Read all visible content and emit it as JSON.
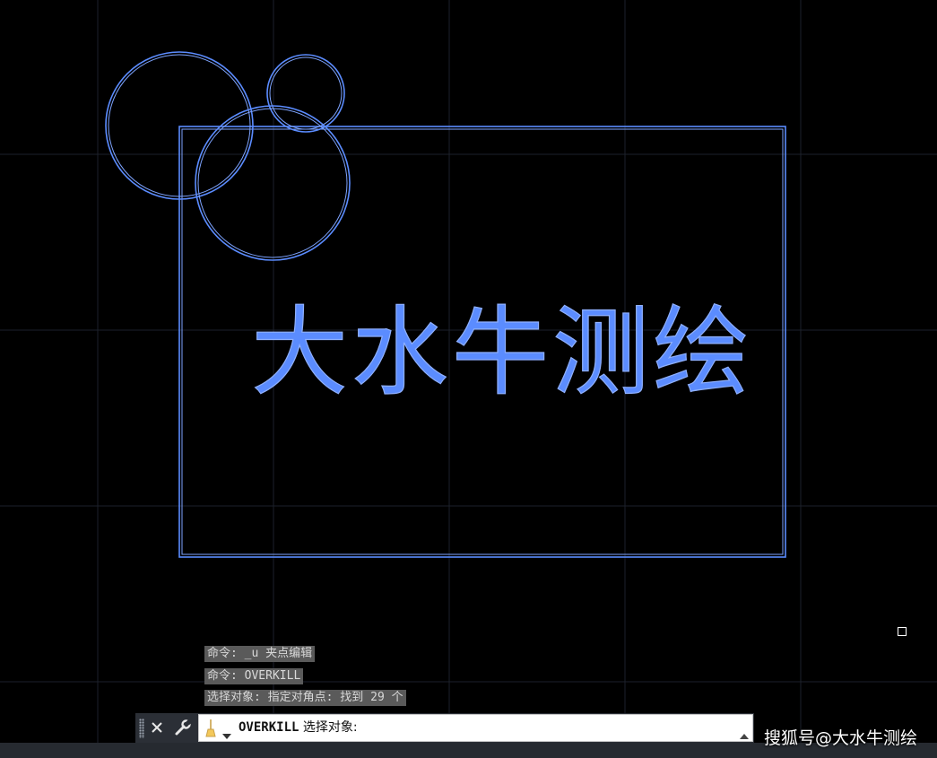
{
  "drawing": {
    "text": "大水牛测绘",
    "entity_color": "#5b8cff",
    "grid_color": "#1c212b"
  },
  "command_history": [
    "命令: _u 夹点编辑",
    "命令: OVERKILL",
    "选择对象: 指定对角点: 找到 29 个"
  ],
  "command_bar": {
    "close_icon": "close-icon",
    "customize_icon": "wrench-icon",
    "command_icon": "broom-icon",
    "keyword": "OVERKILL",
    "prompt": "选择对象:",
    "history_toggle_icon": "caret-up-icon"
  },
  "watermark": "搜狐号@大水牛测绘"
}
